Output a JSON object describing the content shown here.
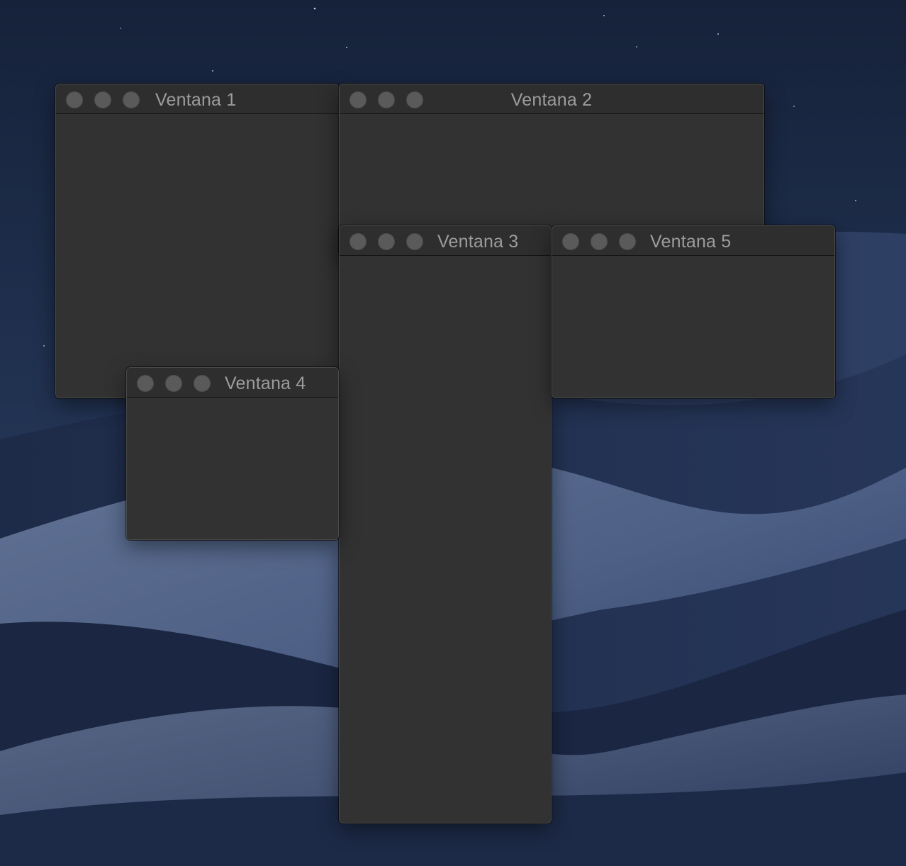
{
  "desktop": {
    "wallpaper": "night-desert-dunes"
  },
  "windows": [
    {
      "title": "Ventana 1"
    },
    {
      "title": "Ventana 2"
    },
    {
      "title": "Ventana 3"
    },
    {
      "title": "Ventana 4"
    },
    {
      "title": "Ventana 5"
    }
  ],
  "colors": {
    "window_background": "#323232",
    "titlebar_background": "#2e2e2e",
    "traffic_light_inactive": "#5a5a5a",
    "title_text": "#9c9c9c"
  }
}
